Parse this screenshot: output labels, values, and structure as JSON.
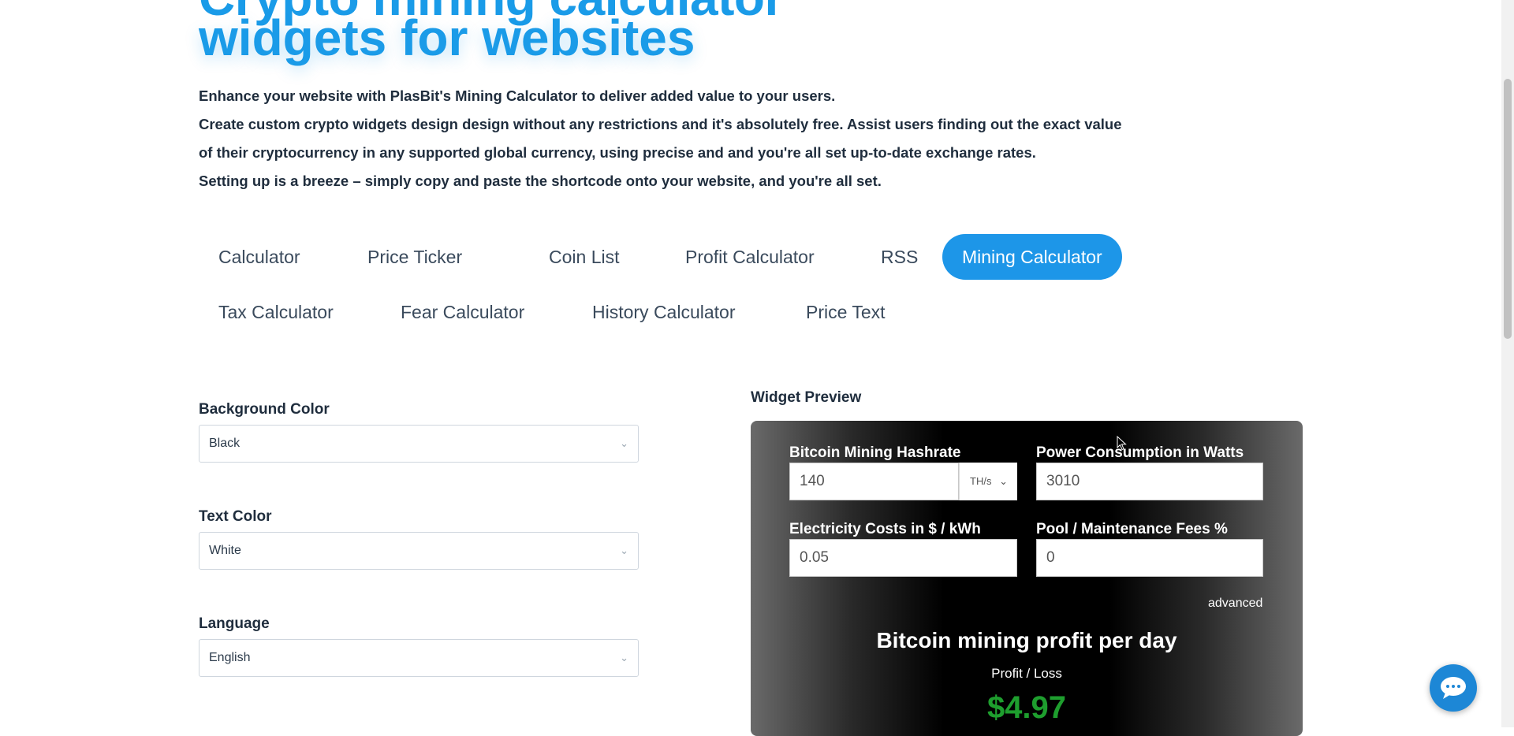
{
  "hero": {
    "line1_partial": "Crypto mining calculator",
    "line2": "widgets for websites"
  },
  "intro": {
    "p1": "Enhance your website with PlasBit's Mining Calculator to deliver added value to your users.",
    "p2": "Create custom crypto widgets design design without any restrictions and it's absolutely free. Assist users finding out the exact value of their cryptocurrency in any supported global currency, using precise and and you're all set up-to-date exchange rates.",
    "p3": "Setting up is a breeze – simply copy and paste the shortcode onto your website, and you're all set."
  },
  "tabs": [
    {
      "label": "Calculator"
    },
    {
      "label": "Price Ticker"
    },
    {
      "label": "Coin List"
    },
    {
      "label": "Profit Calculator"
    },
    {
      "label": "RSS"
    },
    {
      "label": "Mining Calculator",
      "active": true
    },
    {
      "label": "Tax Calculator"
    },
    {
      "label": "Fear Calculator"
    },
    {
      "label": "History Calculator"
    },
    {
      "label": "Price Text"
    }
  ],
  "settings": {
    "background_color": {
      "label": "Background Color",
      "value": "Black"
    },
    "text_color": {
      "label": "Text Color",
      "value": "White"
    },
    "language": {
      "label": "Language",
      "value": "English"
    }
  },
  "preview": {
    "label": "Widget Preview",
    "hashrate_label": "Bitcoin Mining Hashrate",
    "hashrate_value": "140",
    "hashrate_unit": "TH/s",
    "power_label": "Power Consumption in Watts",
    "power_value": "3010",
    "electricity_label": "Electricity Costs in $ / kWh",
    "electricity_value": "0.05",
    "fees_label": "Pool / Maintenance Fees %",
    "fees_value": "0",
    "advanced": "advanced",
    "title": "Bitcoin mining profit per day",
    "subtitle": "Profit / Loss",
    "profit": "$4.97"
  },
  "colors": {
    "accent": "#1d96e8",
    "profit_green": "#1e9e2e"
  }
}
